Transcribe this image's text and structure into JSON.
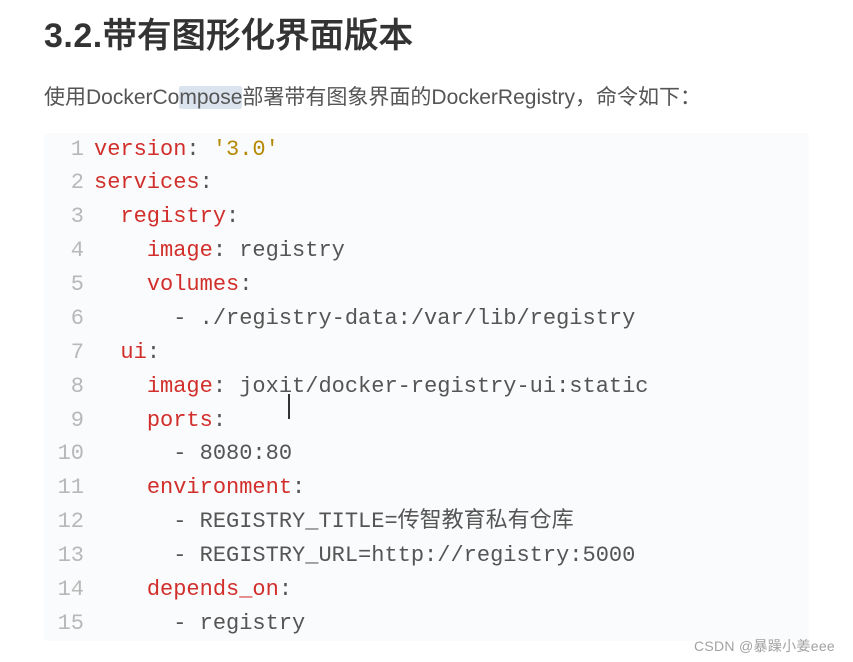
{
  "heading": "3.2.带有图形化界面版本",
  "desc": {
    "pre": "使用DockerCo",
    "hl": "mpose",
    "post": "部署带有图象界面的DockerRegistry，命令如下："
  },
  "code": [
    {
      "n": "1",
      "key": "version",
      "colon": ":",
      "val": "'3.0'"
    },
    {
      "n": "2",
      "key": "services",
      "colon": ":"
    },
    {
      "n": "3",
      "indent": "  ",
      "key": "registry",
      "colon": ":"
    },
    {
      "n": "4",
      "indent": "    ",
      "key": "image",
      "colon": ":",
      "val": "registry"
    },
    {
      "n": "5",
      "indent": "    ",
      "key": "volumes",
      "colon": ":"
    },
    {
      "n": "6",
      "indent": "      ",
      "dash": "-",
      "val": "./registry-data:/var/lib/registry"
    },
    {
      "n": "7",
      "indent": "  ",
      "key": "ui",
      "colon": ":"
    },
    {
      "n": "8",
      "indent": "    ",
      "key": "image",
      "colon": ":",
      "val": "joxit/docker-registry-ui:static"
    },
    {
      "n": "9",
      "indent": "    ",
      "key": "ports",
      "colon": ":"
    },
    {
      "n": "10",
      "indent": "      ",
      "dash": "-",
      "val": "8080:80"
    },
    {
      "n": "11",
      "indent": "    ",
      "key": "environment",
      "colon": ":"
    },
    {
      "n": "12",
      "indent": "      ",
      "dash": "-",
      "val": "REGISTRY_TITLE=传智教育私有仓库"
    },
    {
      "n": "13",
      "indent": "      ",
      "dash": "-",
      "val": "REGISTRY_URL=http://registry:5000"
    },
    {
      "n": "14",
      "indent": "    ",
      "key": "depends_on",
      "colon": ":"
    },
    {
      "n": "15",
      "indent": "      ",
      "dash": "-",
      "val": "registry"
    }
  ],
  "watermark": "CSDN @暴躁小姜eee"
}
